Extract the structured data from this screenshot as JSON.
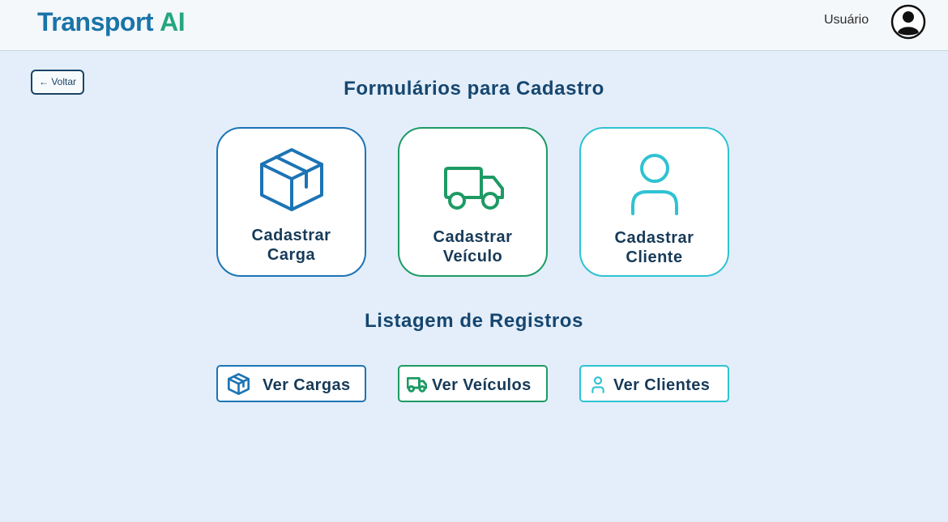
{
  "header": {
    "logo_part1": "Transport",
    "logo_part2": "AI",
    "user_label": "Usuário",
    "avatar_icon": "user-circle-icon"
  },
  "nav": {
    "back_label": "← Voltar"
  },
  "forms_section": {
    "title": "Formulários para Cadastro",
    "cards": [
      {
        "line1": "Cadastrar",
        "line2": "Carga",
        "icon": "box-icon",
        "color": "#1c74b4"
      },
      {
        "line1": "Cadastrar",
        "line2": "Veículo",
        "icon": "truck-icon",
        "color": "#1e9a64"
      },
      {
        "line1": "Cadastrar",
        "line2": "Cliente",
        "icon": "user-icon",
        "color": "#2fc2d2"
      }
    ]
  },
  "list_section": {
    "title": "Listagem de Registros",
    "buttons": [
      {
        "label": "Ver Cargas",
        "icon": "box-icon",
        "color": "#1c74b4"
      },
      {
        "label": "Ver Veículos",
        "icon": "truck-icon",
        "color": "#1e9a64"
      },
      {
        "label": "Ver Clientes",
        "icon": "user-icon",
        "color": "#2fc2d2"
      }
    ]
  },
  "colors": {
    "background": "#e3eefa",
    "header_bg": "#f5f8fb",
    "logo_blue": "#1a74a8",
    "logo_green": "#23a77c",
    "title": "#16466f"
  }
}
